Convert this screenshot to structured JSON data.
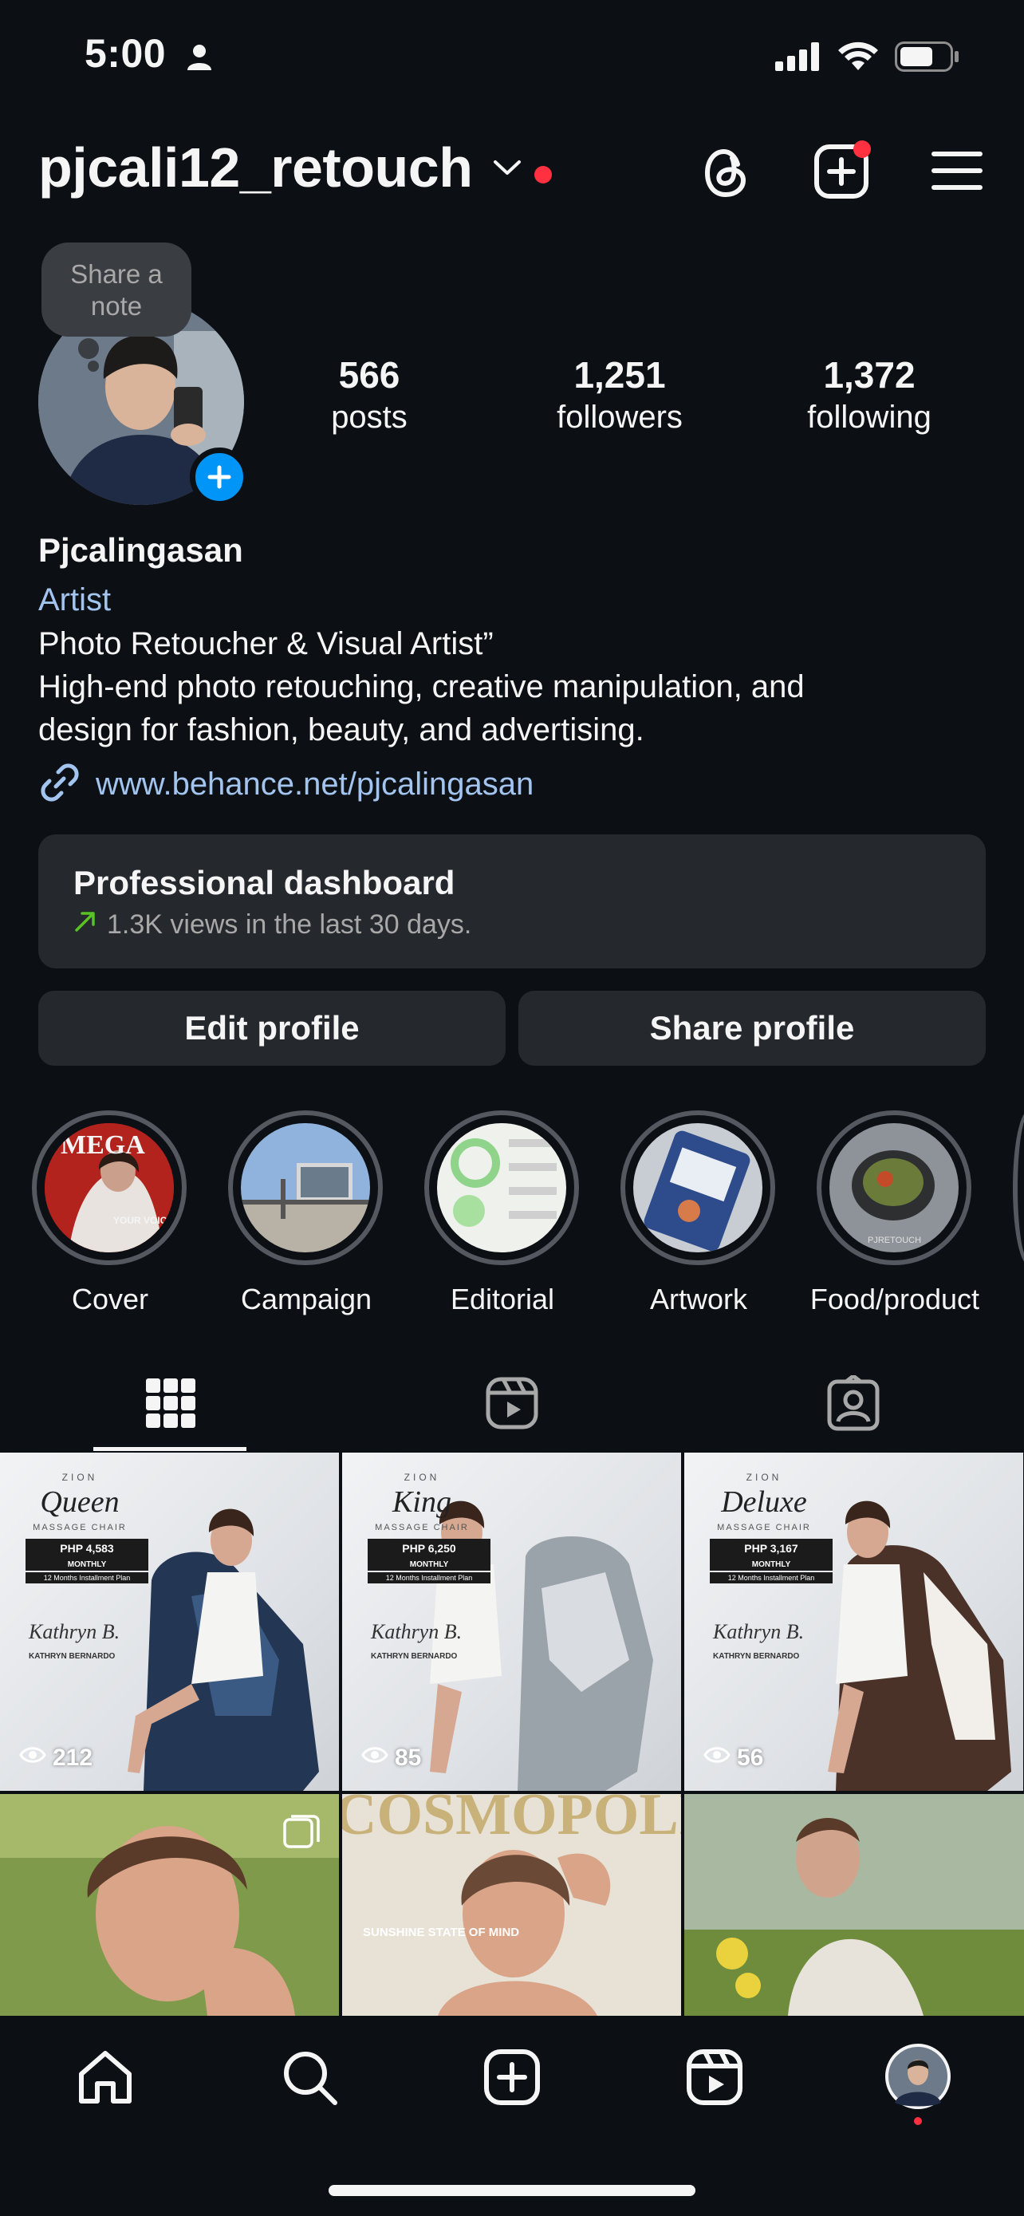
{
  "status_bar": {
    "time": "5:00",
    "icons": [
      "person-icon",
      "signal-icon",
      "wifi-icon",
      "battery-icon"
    ]
  },
  "header": {
    "username": "pjcali12_retouch",
    "icons": [
      "chevron-down-icon",
      "threads-icon",
      "create-icon",
      "menu-icon"
    ],
    "notification_color": "#ff3040"
  },
  "note": {
    "text": "Share a note"
  },
  "stats": [
    {
      "value": "566",
      "label": "posts"
    },
    {
      "value": "1,251",
      "label": "followers"
    },
    {
      "value": "1,372",
      "label": "following"
    }
  ],
  "bio": {
    "name": "Pjcalingasan",
    "category": "Artist",
    "lines": [
      "Photo Retoucher & Visual Artist”",
      "High-end photo retouching, creative manipulation, and",
      "design for fashion, beauty, and advertising."
    ],
    "link": "www.behance.net/pjcalingasan"
  },
  "dashboard": {
    "title": "Professional dashboard",
    "subtitle": "1.3K views in the last 30 days."
  },
  "buttons": {
    "edit": "Edit profile",
    "share": "Share profile"
  },
  "highlights": [
    {
      "label": "Cover"
    },
    {
      "label": "Campaign"
    },
    {
      "label": "Editorial"
    },
    {
      "label": "Artwork"
    },
    {
      "label": "Food/product"
    }
  ],
  "highlight_texts": {
    "cover_mag": "MEGA",
    "cover_voice": "YOUR VOICE",
    "food_caption": "PJRETOUCH"
  },
  "tabs": [
    "grid-icon",
    "reels-icon",
    "tagged-icon"
  ],
  "posts": [
    {
      "brand": "ZION",
      "model": "Queen",
      "subtitle": "MASSAGE CHAIR",
      "price": "PHP 4,583",
      "period": "MONTHLY",
      "plan": "12 Months Installment Plan",
      "signature": "Kathryn B.",
      "ambassador": "KATHRYN BERNARDO",
      "views": "212"
    },
    {
      "brand": "ZION",
      "model": "King",
      "subtitle": "MASSAGE CHAIR",
      "price": "PHP 6,250",
      "period": "MONTHLY",
      "plan": "12 Months Installment Plan",
      "signature": "Kathryn B.",
      "ambassador": "KATHRYN BERNARDO",
      "views": "85"
    },
    {
      "brand": "ZION",
      "model": "Deluxe",
      "subtitle": "MASSAGE CHAIR",
      "price": "PHP 3,167",
      "period": "MONTHLY",
      "plan": "12 Months Installment Plan",
      "signature": "Kathryn B.",
      "ambassador": "KATHRYN BERNARDO",
      "views": "56"
    }
  ],
  "posts_row2": {
    "magazine": "COSMOPOLITAN",
    "magazine_sub": "SUNSHINE STATE OF MIND"
  },
  "bottom_nav": [
    "home-icon",
    "search-icon",
    "create-icon",
    "reels-icon",
    "profile-avatar"
  ],
  "colors": {
    "background": "#0c1014",
    "surface": "#25282d",
    "link": "#a2c4ef",
    "accent_blue": "#0095f6"
  }
}
